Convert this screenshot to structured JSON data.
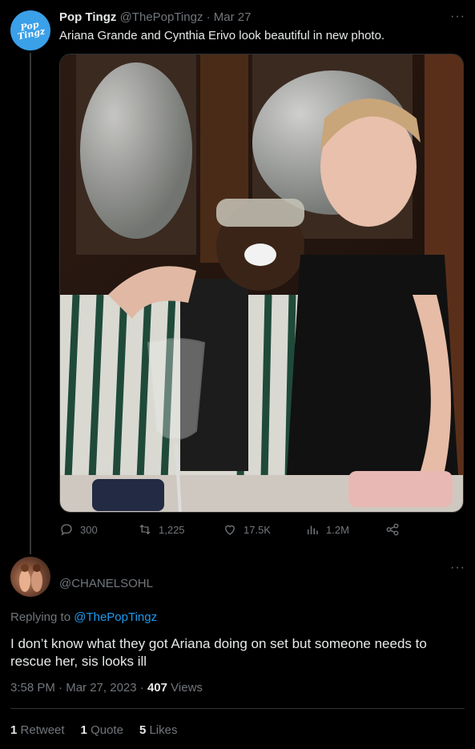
{
  "parent_tweet": {
    "author_name": "Pop Tingz",
    "author_handle": "@ThePopTingz",
    "separator": "·",
    "date": "Mar 27",
    "avatar_logo_lines": [
      "Pop",
      "Tingz"
    ],
    "text": "Ariana Grande and Cynthia Erivo look beautiful in new photo.",
    "actions": {
      "replies": "300",
      "retweets": "1,225",
      "likes": "17.5K",
      "views": "1.2M"
    }
  },
  "reply_tweet": {
    "author_handle": "@CHANELSOHL",
    "replying_prefix": "Replying to",
    "replying_to": "@ThePopTingz",
    "text": "I don’t know what they got Ariana doing on set but someone needs to rescue her, sis looks ill",
    "time": "3:58 PM",
    "separator": "·",
    "date": "Mar 27, 2023",
    "separator2": "·",
    "views_count": "407",
    "views_label": "Views",
    "stats": [
      {
        "count": "1",
        "label": "Retweet"
      },
      {
        "count": "1",
        "label": "Quote"
      },
      {
        "count": "5",
        "label": "Likes"
      }
    ]
  },
  "icons": {
    "more": "more-icon",
    "reply": "reply-icon",
    "retweet": "retweet-icon",
    "like": "heart-icon",
    "views": "views-icon",
    "share": "share-icon"
  },
  "colors": {
    "background": "#000000",
    "text_primary": "#e7e9ea",
    "text_secondary": "#71767b",
    "link": "#1d9bf0",
    "avatar_brand": "#3aa0e8",
    "divider": "#2f3336"
  }
}
